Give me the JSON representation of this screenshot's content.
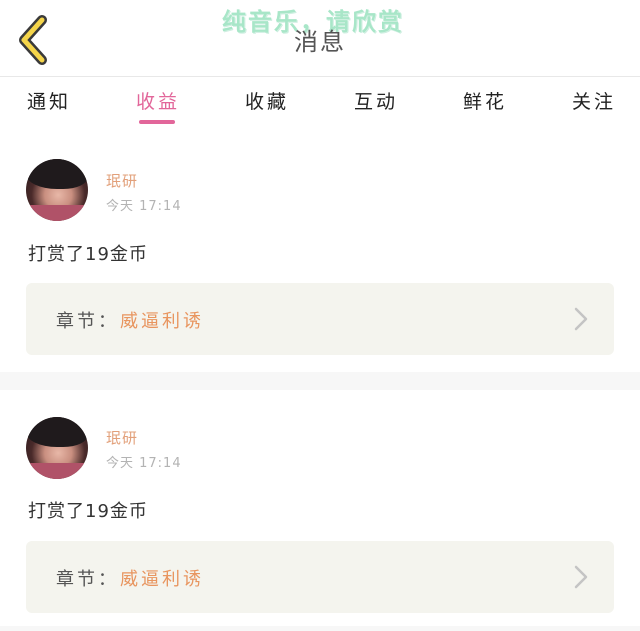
{
  "watermark": "纯音乐，请欣赏",
  "header": {
    "title": "消息"
  },
  "tabs": [
    {
      "label": "通知"
    },
    {
      "label": "收益"
    },
    {
      "label": "收藏"
    },
    {
      "label": "互动"
    },
    {
      "label": "鲜花"
    },
    {
      "label": "关注"
    }
  ],
  "active_tab": "收益",
  "notifications": [
    {
      "username": "珉研",
      "timestamp": "今天 17:14",
      "message": "打赏了19金币",
      "chapter_label": "章节：",
      "chapter_title": "威逼利诱"
    },
    {
      "username": "珉研",
      "timestamp": "今天 17:14",
      "message": "打赏了19金币",
      "chapter_label": "章节：",
      "chapter_title": "威逼利诱"
    }
  ],
  "colors": {
    "accent_pink": "#e2669a",
    "username_orange": "#e2a07a",
    "chapter_orange": "#e8955f",
    "back_arrow_yellow": "#f5d54a",
    "card_box": "#f4f4ee"
  },
  "icons": {
    "back": "back-arrow-icon",
    "chevron": "chevron-right-icon",
    "avatar": "user-avatar"
  }
}
